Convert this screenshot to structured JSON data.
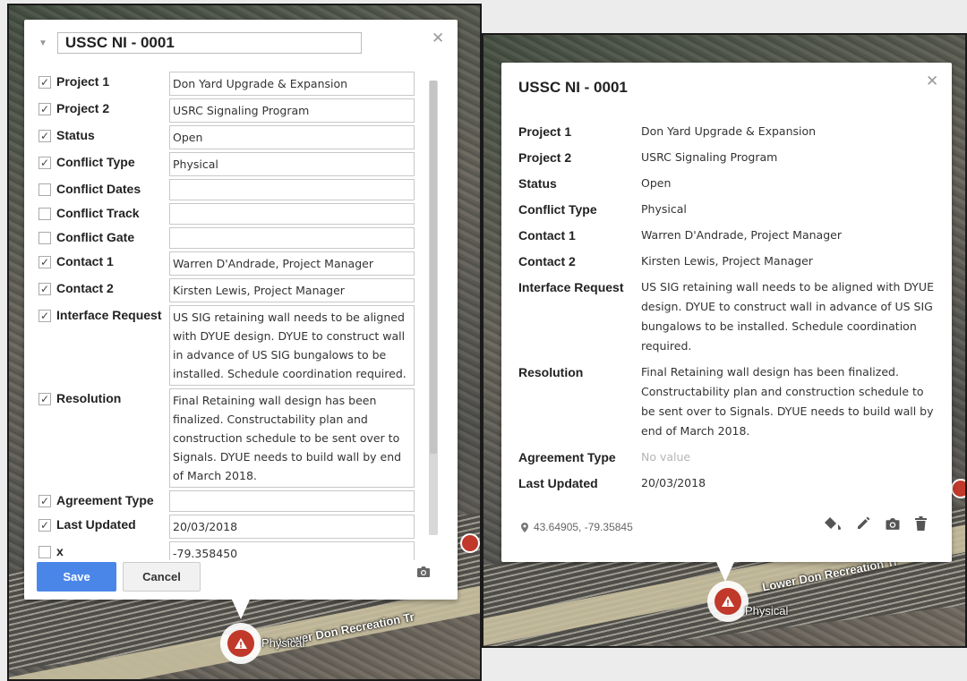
{
  "left_panel": {
    "title": "USSC NI - 0001",
    "fields": [
      {
        "checked": true,
        "label": "Project 1",
        "value": "Don Yard Upgrade & Expansion"
      },
      {
        "checked": true,
        "label": "Project 2",
        "value": "USRC Signaling Program"
      },
      {
        "checked": true,
        "label": "Status",
        "value": "Open"
      },
      {
        "checked": true,
        "label": "Conflict Type",
        "value": "Physical"
      },
      {
        "checked": false,
        "label": "Conflict Dates",
        "value": ""
      },
      {
        "checked": false,
        "label": "Conflict Track",
        "value": ""
      },
      {
        "checked": false,
        "label": "Conflict Gate",
        "value": ""
      },
      {
        "checked": true,
        "label": "Contact 1",
        "value": "Warren D'Andrade, Project Manager"
      },
      {
        "checked": true,
        "label": "Contact 2",
        "value": "Kirsten Lewis, Project Manager"
      },
      {
        "checked": true,
        "label": "Interface Request",
        "value": "US SIG retaining wall needs to be aligned with DYUE design. DYUE to construct wall in advance of US SIG bungalows to be installed. Schedule coordination required."
      },
      {
        "checked": true,
        "label": "Resolution",
        "value": "Final Retaining wall design has been finalized. Constructability plan and construction schedule to be sent over to Signals. DYUE needs to build wall by end of March 2018."
      },
      {
        "checked": true,
        "label": "Agreement Type",
        "value": ""
      },
      {
        "checked": true,
        "label": "Last Updated",
        "value": "20/03/2018"
      },
      {
        "checked": false,
        "label": "x",
        "value": "-79.358450"
      }
    ],
    "save_label": "Save",
    "cancel_label": "Cancel",
    "marker_label": "Physical",
    "road_label": "Lower Don Recreation Tr"
  },
  "right_panel": {
    "title": "USSC NI - 0001",
    "fields": [
      {
        "label": "Project 1",
        "value": "Don Yard Upgrade & Expansion"
      },
      {
        "label": "Project 2",
        "value": "USRC Signaling Program"
      },
      {
        "label": "Status",
        "value": "Open"
      },
      {
        "label": "Conflict Type",
        "value": "Physical"
      },
      {
        "label": "Contact 1",
        "value": "Warren D'Andrade, Project Manager"
      },
      {
        "label": "Contact 2",
        "value": "Kirsten Lewis, Project Manager"
      },
      {
        "label": "Interface Request",
        "value": "US SIG retaining wall needs to be aligned with DYUE design. DYUE to construct wall in advance of US SIG bungalows to be installed. Schedule coordination required."
      },
      {
        "label": "Resolution",
        "value": "Final Retaining wall design has been finalized. Constructability plan and construction schedule to be sent over to Signals. DYUE needs to build wall by end of March 2018."
      },
      {
        "label": "Agreement Type",
        "value": "No value",
        "muted": true
      },
      {
        "label": "Last Updated",
        "value": "20/03/2018"
      }
    ],
    "coords": "43.64905, -79.35845",
    "marker_label": "Physical",
    "road_label": "Lower Don Recreation Tr"
  },
  "icons": {
    "close": "close-icon",
    "camera": "camera-icon",
    "pin": "pin-icon",
    "paint": "paint-bucket-icon",
    "edit": "pencil-icon",
    "delete": "trash-icon",
    "warning": "warning-icon"
  },
  "colors": {
    "save_button": "#4a86e8",
    "marker": "#c0392b"
  }
}
